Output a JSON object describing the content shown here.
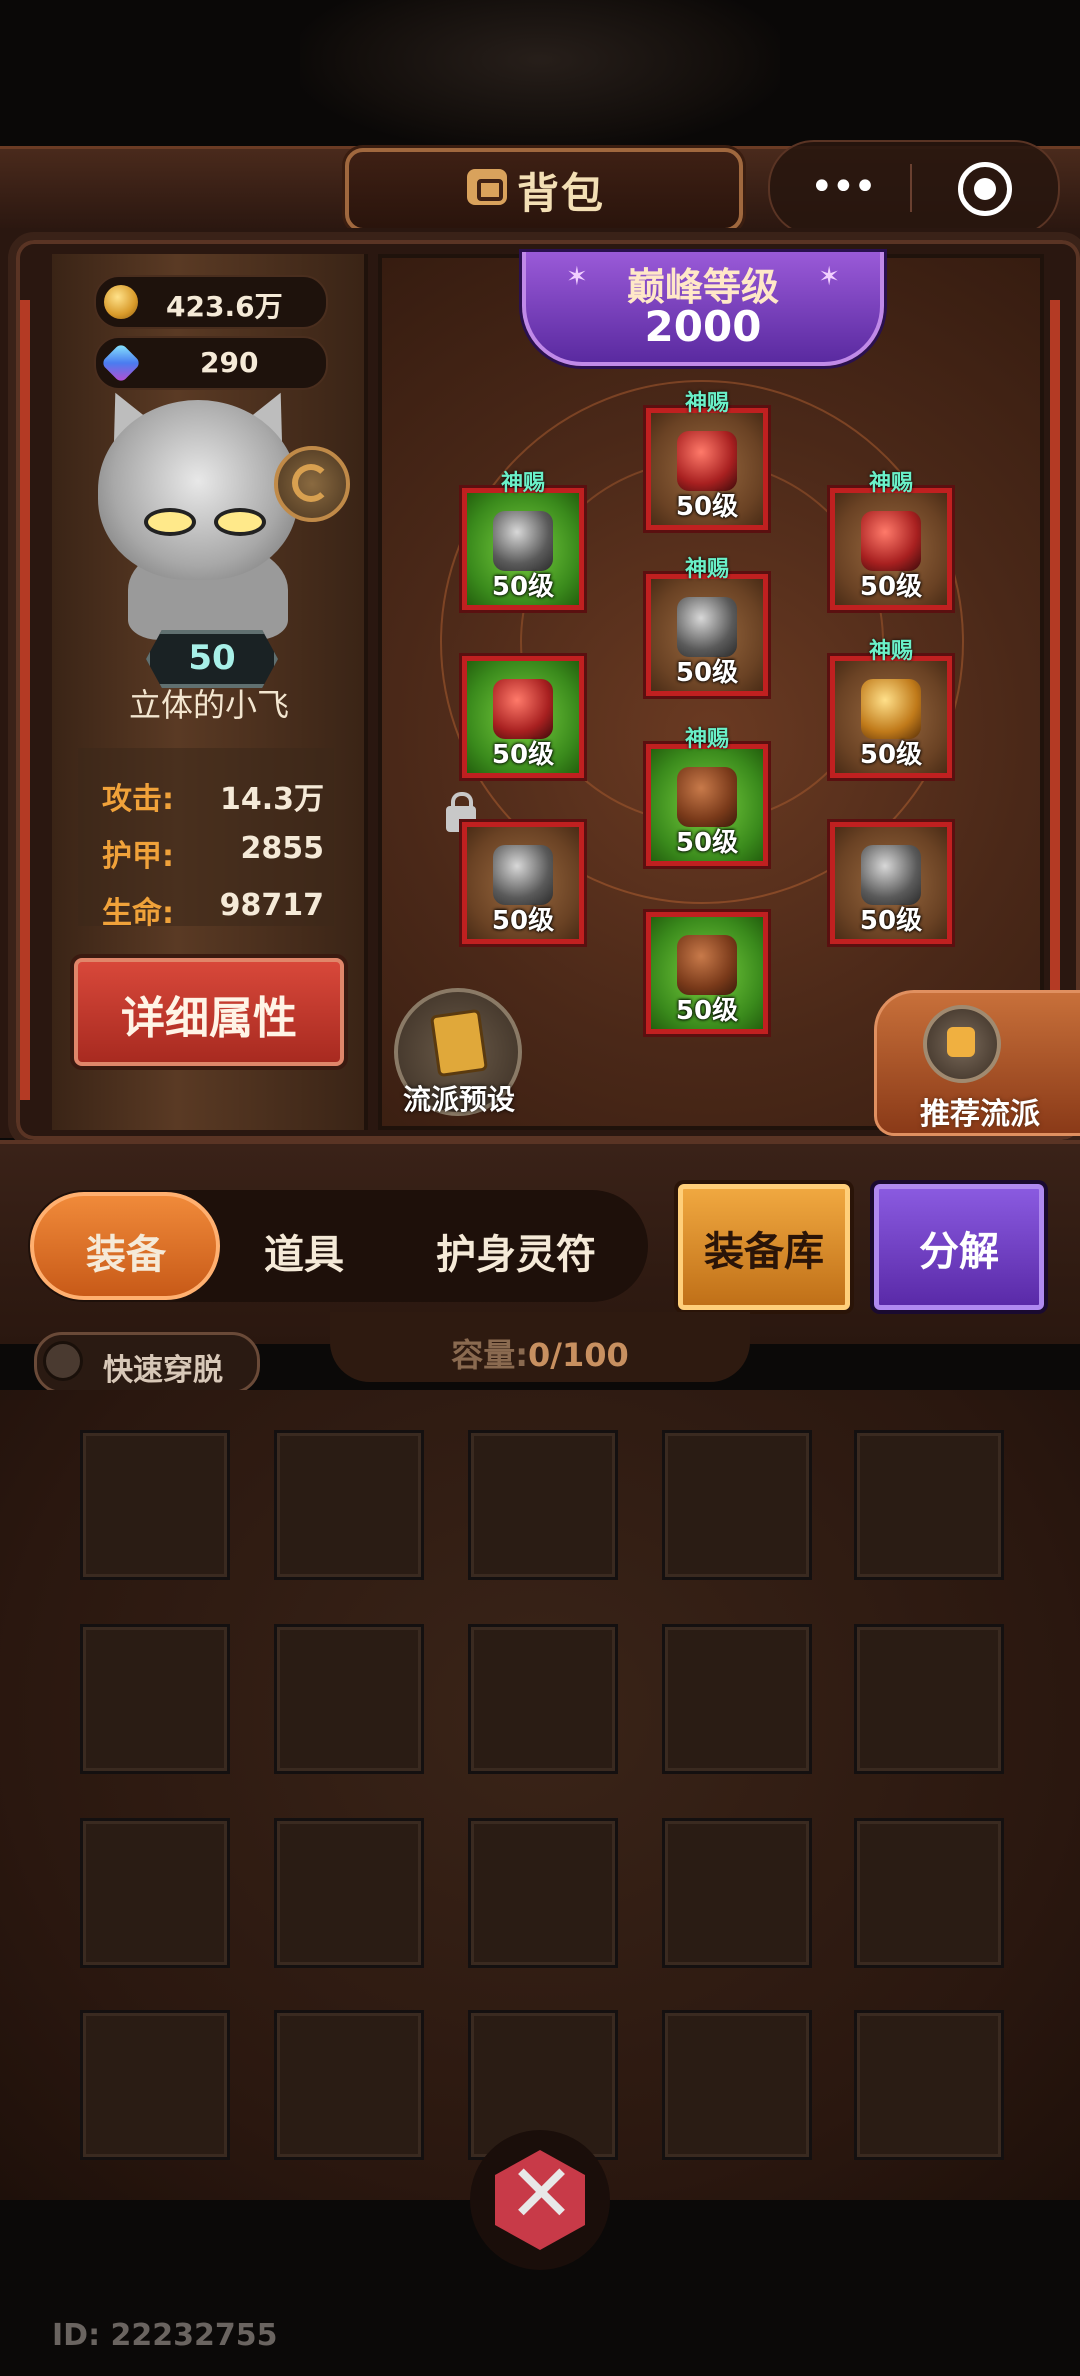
{
  "header": {
    "title": "背包",
    "menu_dots": "•••"
  },
  "resources": {
    "gold": "423.6万",
    "gems": "290"
  },
  "character": {
    "level": "50",
    "name": "立体的小飞",
    "stats": [
      {
        "label": "攻击:",
        "value": "14.3万"
      },
      {
        "label": "护甲:",
        "value": "2855"
      },
      {
        "label": "生命:",
        "value": "98717"
      }
    ],
    "detail_button": "详细属性"
  },
  "peak": {
    "label": "巅峰等级",
    "value": "2000"
  },
  "equipment": [
    {
      "slot": "helmet",
      "level": "50级",
      "tag": "神赐",
      "bg": "brown",
      "item": "red"
    },
    {
      "slot": "shoulder",
      "level": "50级",
      "tag": "神赐",
      "bg": "green",
      "item": "gray"
    },
    {
      "slot": "necklace",
      "level": "50级",
      "tag": "神赐",
      "bg": "brown",
      "item": "red"
    },
    {
      "slot": "armor",
      "level": "50级",
      "tag": "神赐",
      "bg": "brown",
      "item": "gray"
    },
    {
      "slot": "gloves",
      "level": "50级",
      "tag": "",
      "bg": "green",
      "item": "red"
    },
    {
      "slot": "ring",
      "level": "50级",
      "tag": "神赐",
      "bg": "brown",
      "item": "gold"
    },
    {
      "slot": "pants",
      "level": "50级",
      "tag": "神赐",
      "bg": "green",
      "item": "leather"
    },
    {
      "slot": "lantern",
      "level": "50级",
      "tag": "",
      "bg": "brown",
      "item": "gray",
      "locked": true
    },
    {
      "slot": "amulet",
      "level": "50级",
      "tag": "",
      "bg": "brown",
      "item": "gray"
    },
    {
      "slot": "boots",
      "level": "50级",
      "tag": "",
      "bg": "green",
      "item": "leather"
    }
  ],
  "preset_label": "流派预设",
  "recommend_label": "推荐流派",
  "tabs": [
    "装备",
    "道具",
    "护身灵符"
  ],
  "active_tab": "装备",
  "buttons": {
    "library": "装备库",
    "disassemble": "分解"
  },
  "quick_toggle": "快速穿脱",
  "capacity": {
    "label": "容量:",
    "value": "0/100"
  },
  "user_id": "ID: 22232755",
  "colors": {
    "accent_orange": "#f08a3a",
    "purple": "#7a4ad0",
    "slot_border": "#c02020"
  }
}
